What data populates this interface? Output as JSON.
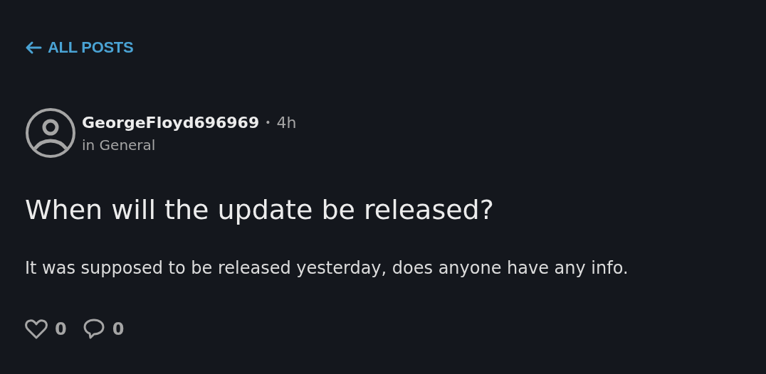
{
  "back_link": {
    "label": "ALL POSTS"
  },
  "post": {
    "author": "GeorgeFloyd696969",
    "separator": "•",
    "age": "4h",
    "category": "in General",
    "title": "When will the update be released?",
    "body": "It was supposed to be released yesterday, does anyone have any info.",
    "likes": {
      "count": "0",
      "liked": false
    },
    "comments": {
      "count": "0"
    }
  }
}
